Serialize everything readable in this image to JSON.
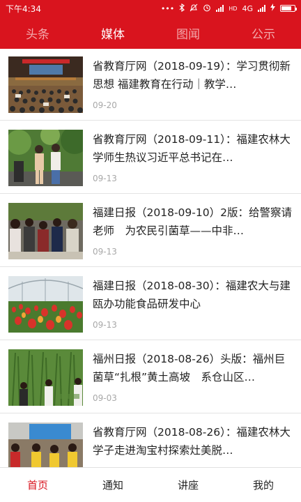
{
  "status_bar": {
    "time": "下午4:34",
    "icons": [
      "more-dots-icon",
      "bluetooth-icon",
      "mute-icon",
      "alarm-icon",
      "signal-icon",
      "hd-icon",
      "network-type",
      "signal-icon",
      "charging-icon",
      "battery-icon"
    ],
    "hd_label": "HD",
    "network": "4G",
    "battery_level": 0.8
  },
  "tabs": [
    {
      "label": "头条",
      "active": false
    },
    {
      "label": "媒体",
      "active": true
    },
    {
      "label": "图闻",
      "active": false
    },
    {
      "label": "公示",
      "active": false
    }
  ],
  "news": [
    {
      "title": "省教育厅网（2018-09-19）：学习贯彻新思想 福建教育在行动｜教学…",
      "date": "09-20",
      "image": "auditorium-lecture"
    },
    {
      "title": "省教育厅网（2018-09-11）：福建农林大学师生热议习近平总书记在…",
      "date": "09-13",
      "image": "two-students-speaking"
    },
    {
      "title": "福建日报（2018-09-10）2版：给警察请老师　为农民引菌草——中非…",
      "date": "09-13",
      "image": "group-meeting"
    },
    {
      "title": "福建日报（2018-08-30）：福建农大与建瓯办功能食品研发中心",
      "date": "09-13",
      "image": "greenhouse-tulips"
    },
    {
      "title": "福州日报（2018-08-26）头版：福州巨菌草“扎根”黄土高坡　系仓山区…",
      "date": "09-03",
      "image": "grass-field-people"
    },
    {
      "title": "省教育厅网（2018-08-26）：福建农林大学子走进淘宝村探索灶美脱…",
      "date": "",
      "image": "classroom-students"
    }
  ],
  "bottom_nav": [
    {
      "label": "首页",
      "active": true
    },
    {
      "label": "通知",
      "active": false
    },
    {
      "label": "讲座",
      "active": false
    },
    {
      "label": "我的",
      "active": false
    }
  ],
  "colors": {
    "brand_red": "#d9141e",
    "inactive_tab": "#f3a9ac",
    "date_gray": "#a8a8a8"
  }
}
